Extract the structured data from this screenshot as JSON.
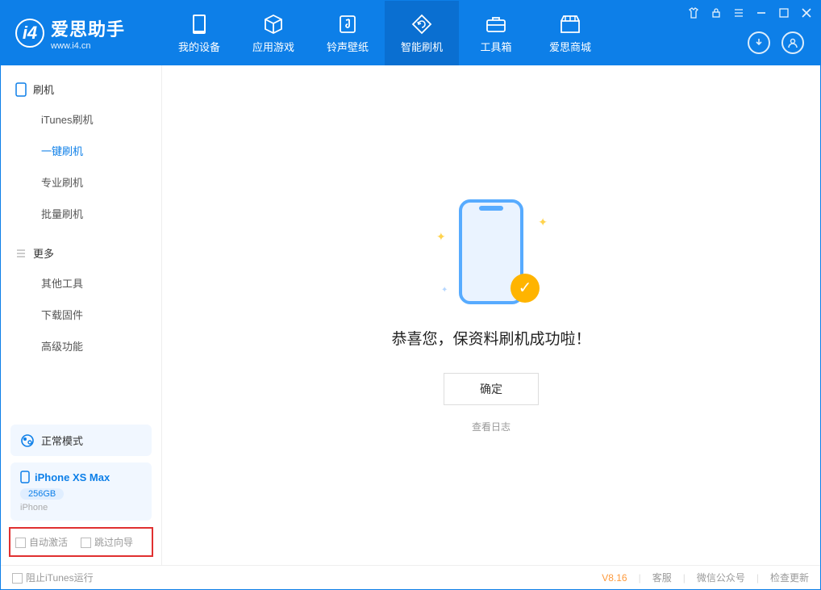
{
  "logo": {
    "main": "爱思助手",
    "sub": "www.i4.cn"
  },
  "nav": {
    "items": [
      {
        "label": "我的设备"
      },
      {
        "label": "应用游戏"
      },
      {
        "label": "铃声壁纸"
      },
      {
        "label": "智能刷机"
      },
      {
        "label": "工具箱"
      },
      {
        "label": "爱思商城"
      }
    ]
  },
  "sidebar": {
    "section1": {
      "title": "刷机",
      "items": [
        "iTunes刷机",
        "一键刷机",
        "专业刷机",
        "批量刷机"
      ]
    },
    "section2": {
      "title": "更多",
      "items": [
        "其他工具",
        "下载固件",
        "高级功能"
      ]
    },
    "mode": "正常模式",
    "device": {
      "name": "iPhone XS Max",
      "capacity": "256GB",
      "type": "iPhone"
    },
    "checks": {
      "auto_activate": "自动激活",
      "skip_guide": "跳过向导"
    }
  },
  "content": {
    "success": "恭喜您，保资料刷机成功啦！",
    "ok": "确定",
    "log": "查看日志"
  },
  "footer": {
    "block_itunes": "阻止iTunes运行",
    "version": "V8.16",
    "service": "客服",
    "wechat": "微信公众号",
    "update": "检查更新"
  }
}
